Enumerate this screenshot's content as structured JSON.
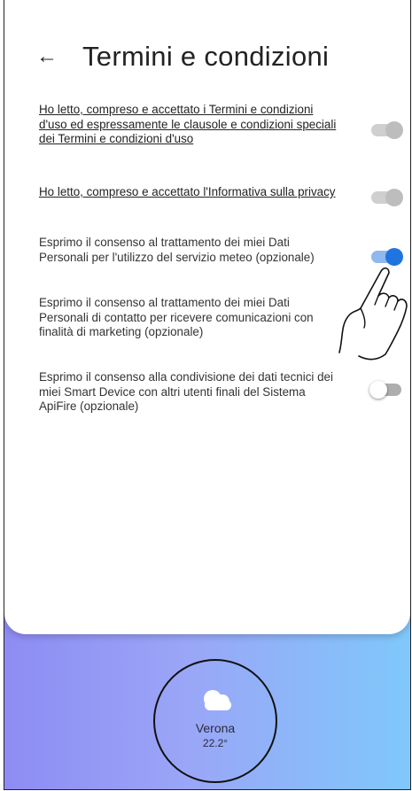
{
  "header": {
    "back_icon": "arrow-left-icon",
    "title": "Termini e condizioni"
  },
  "consents": [
    {
      "text": "Ho letto, compreso e accettato i Termini e condizioni d'uso ed espressamente le clausole e condizioni speciali dei Termini e condizioni d'uso",
      "state": "on-disabled"
    },
    {
      "text": "Ho letto, compreso e accettato l'Informativa sulla privacy",
      "state": "on-disabled"
    },
    {
      "text": "Esprimo il consenso al trattamento dei miei Dati Personali per l'utilizzo del servizio meteo (opzionale)",
      "state": "on"
    },
    {
      "text": "Esprimo il consenso al trattamento dei miei Dati Personali di contatto per ricevere comunicazioni con finalità di marketing (opzionale)",
      "state": "off"
    },
    {
      "text": "Esprimo il consenso alla condivisione dei dati tecnici dei miei Smart Device con altri utenti finali del Sistema ApiFire (opzionale)",
      "state": "off"
    }
  ],
  "weather": {
    "icon": "cloud-icon",
    "city": "Verona",
    "temperature": "22.2°"
  },
  "colors": {
    "toggle_on": "#1f74e0",
    "toggle_track_on": "#8fb8ee",
    "gradient_left": "#8e8cf3",
    "gradient_right": "#7fc8fb"
  }
}
